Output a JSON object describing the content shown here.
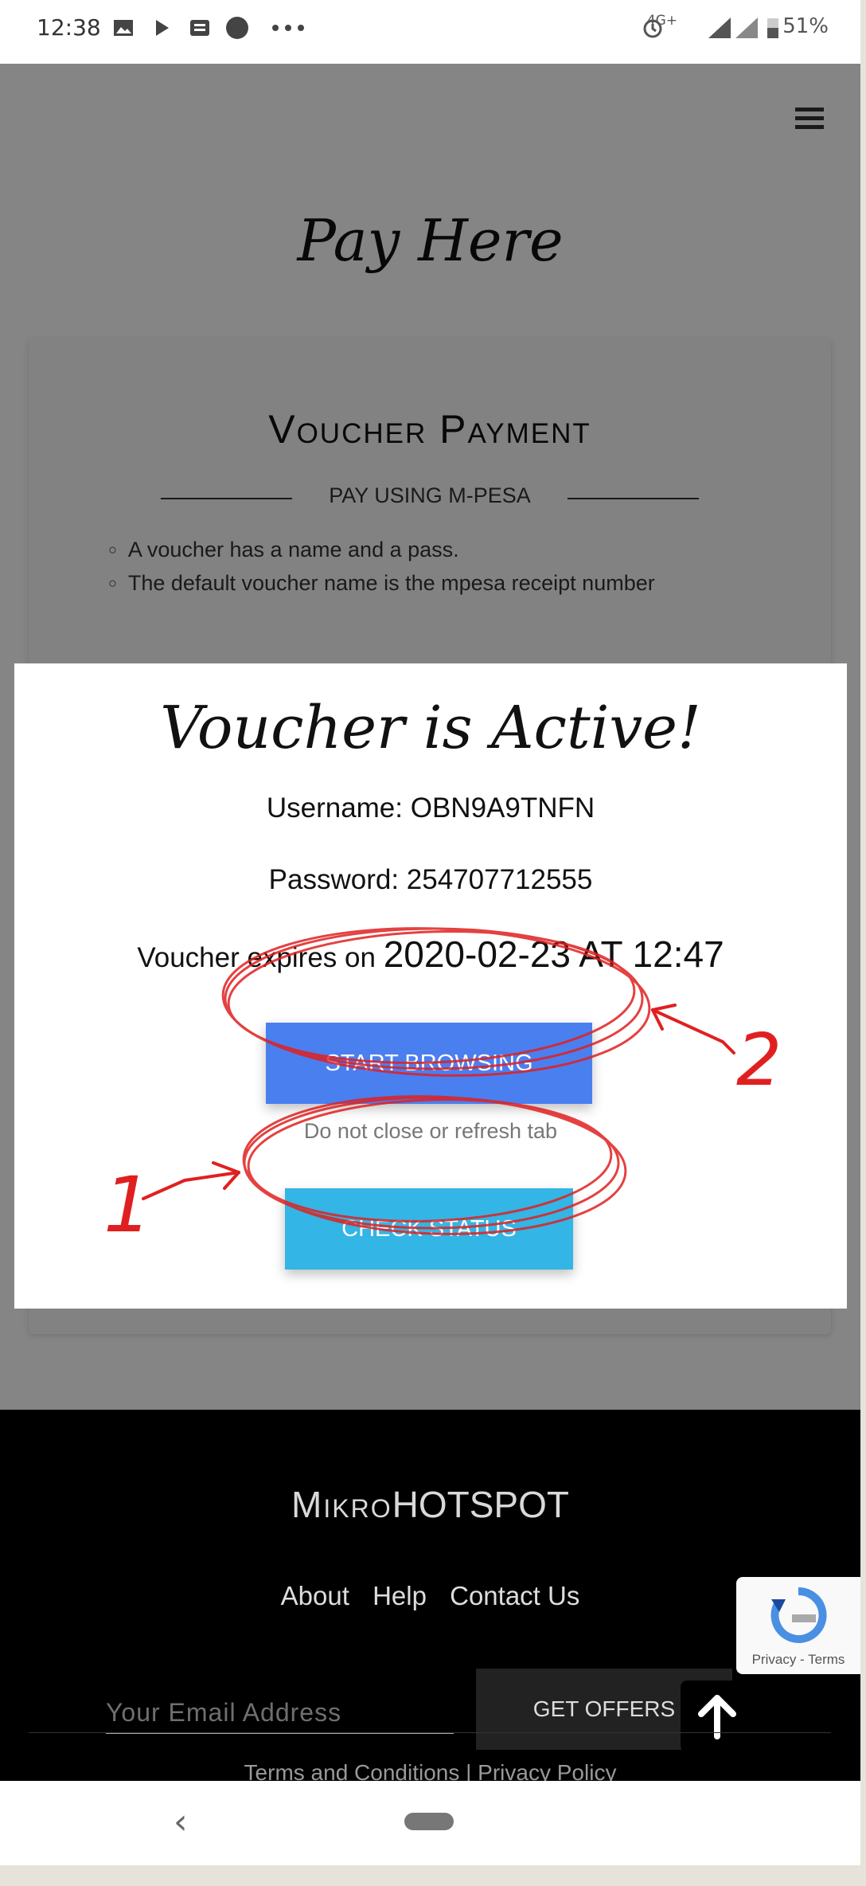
{
  "status_bar": {
    "time": "12:38",
    "network": "4G+",
    "battery": "51%",
    "icons": [
      "image-icon",
      "play-icon",
      "news-icon",
      "circle-icon",
      "more-icon",
      "alarm-icon",
      "signal-icon",
      "battery-icon"
    ]
  },
  "page": {
    "title": "Pay Here",
    "card": {
      "title": "Voucher Payment",
      "subtitle": "PAY USING M-PESA",
      "items": [
        "A voucher has a name and a pass.",
        "The default voucher name is the mpesa receipt number"
      ]
    }
  },
  "modal": {
    "title": "Voucher is Active!",
    "username_line": "Username: OBN9A9TNFN",
    "password_line": "Password: 254707712555",
    "expires_prefix": "Voucher expires on",
    "expires_value": "2020-02-23 AT 12:47",
    "start_button": "START BROWSING",
    "note": "Do not close or refresh tab",
    "check_button": "CHECK STATUS"
  },
  "annotations": {
    "label_1": "1",
    "label_2": "2",
    "color": "#e02020"
  },
  "footer": {
    "logo_part1": "Mikro",
    "logo_part2": "HOTSPOT",
    "links": [
      "About",
      "Help",
      "Contact Us"
    ],
    "email_placeholder": "Your Email Address",
    "offers_button": "GET OFFERS",
    "terms": "Terms and Conditions  |  Privacy Policy",
    "captcha_text": "Privacy - Terms"
  }
}
